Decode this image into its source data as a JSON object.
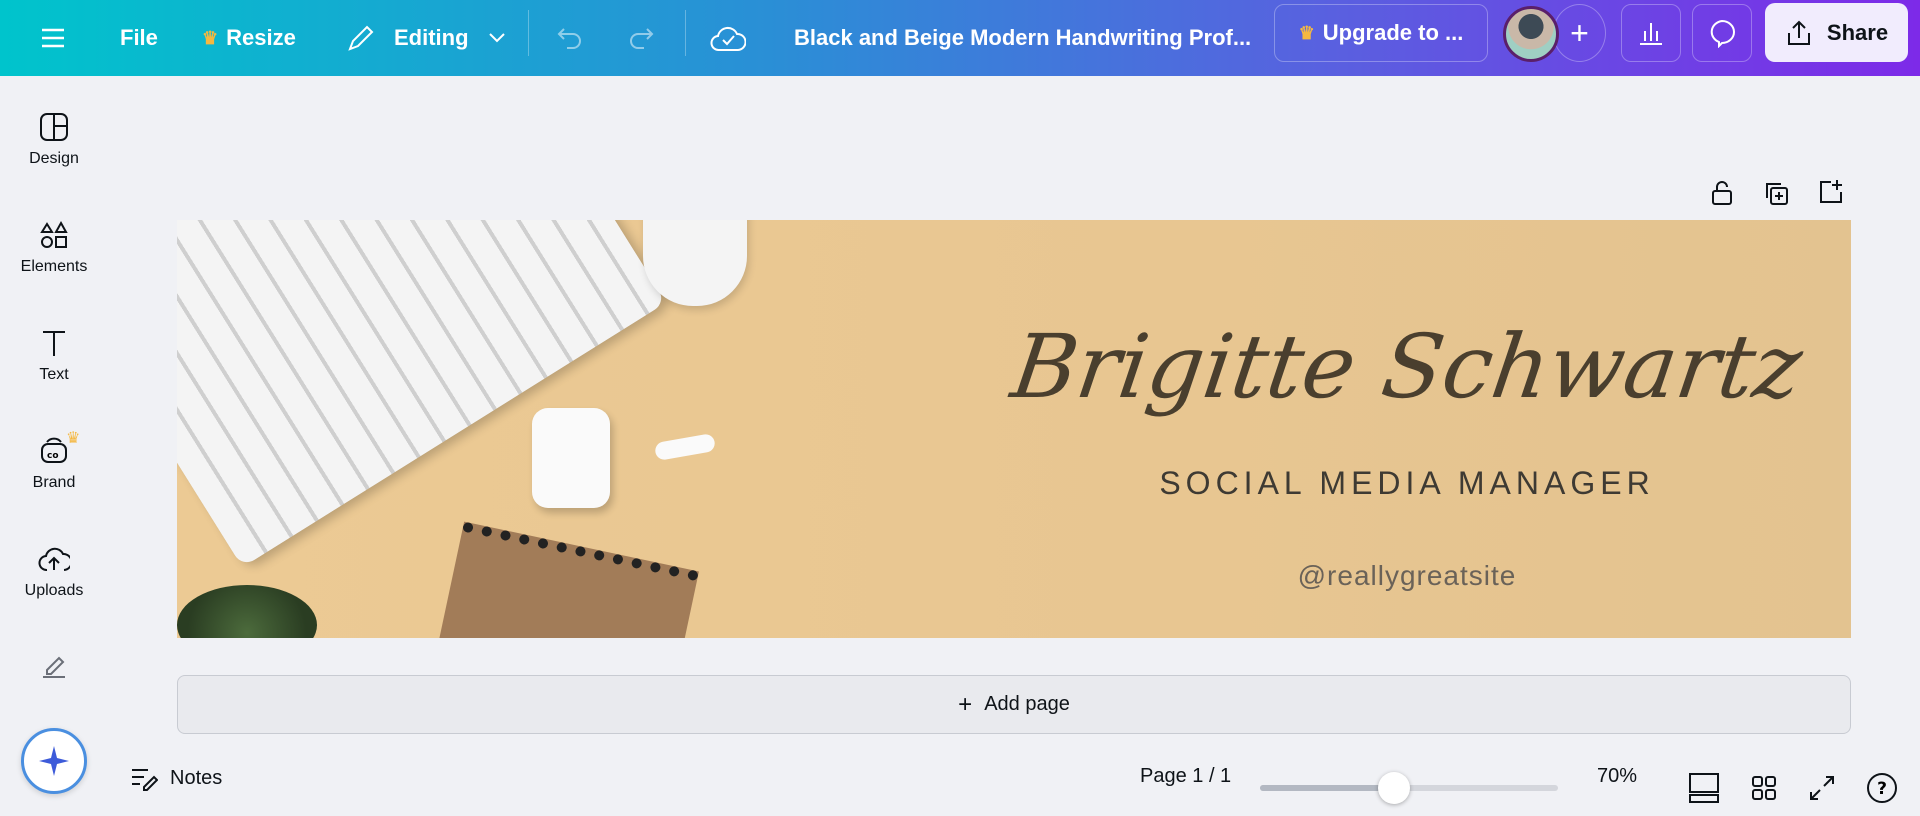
{
  "topbar": {
    "file": "File",
    "resize": "Resize",
    "editing": "Editing",
    "title": "Black and Beige Modern Handwriting Prof...",
    "upgrade": "Upgrade to ...",
    "share": "Share"
  },
  "sidebar": {
    "items": [
      {
        "label": "Design"
      },
      {
        "label": "Elements"
      },
      {
        "label": "Text"
      },
      {
        "label": "Brand"
      },
      {
        "label": "Uploads"
      }
    ]
  },
  "design": {
    "name": "Brigitte Schwartz",
    "role": "SOCIAL MEDIA MANAGER",
    "handle": "@reallygreatsite"
  },
  "add_page": "Add page",
  "bottom": {
    "notes": "Notes",
    "page": "Page 1 / 1",
    "zoom": "70%",
    "zoom_fraction": 0.45
  },
  "colors": {
    "accent": "#7d2ae8",
    "crown": "#f5b841",
    "text_dark": "#4a3f2e"
  }
}
